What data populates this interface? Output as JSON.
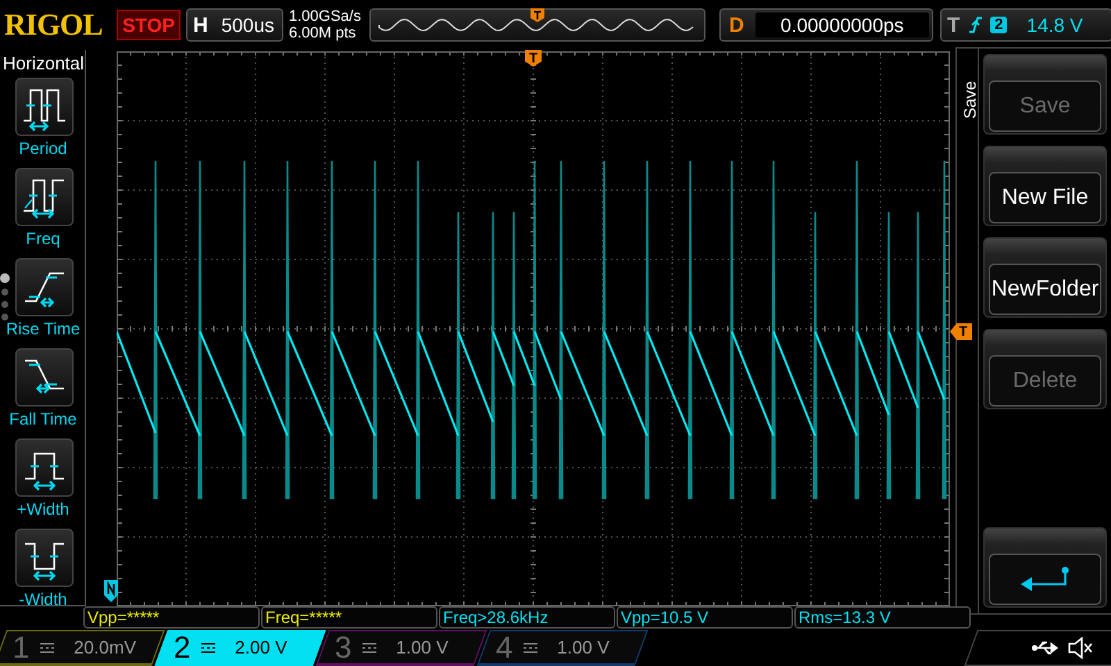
{
  "brand": "RIGOL",
  "run_state": "STOP",
  "horizontal": {
    "label": "H",
    "timebase": "500us",
    "sample_rate": "1.00GSa/s",
    "memory_depth": "6.00M pts"
  },
  "delay": {
    "label": "D",
    "value": "0.00000000ps"
  },
  "trigger": {
    "label": "T",
    "source": "2",
    "level": "14.8 V"
  },
  "measure_menu": {
    "title": "Horizontal",
    "items": [
      {
        "label": "Period",
        "kind": "period"
      },
      {
        "label": "Freq",
        "kind": "freq"
      },
      {
        "label": "Rise Time",
        "kind": "rise"
      },
      {
        "label": "Fall Time",
        "kind": "fall"
      },
      {
        "label": "+Width",
        "kind": "pwidth"
      },
      {
        "label": "-Width",
        "kind": "nwidth"
      }
    ],
    "pages": [
      {
        "selected": true
      },
      {
        "selected": false
      },
      {
        "selected": false
      },
      {
        "selected": false
      }
    ]
  },
  "markers": {
    "trigger_position": "T",
    "trigger_level": "T"
  },
  "measurements": [
    {
      "text": "Vpp=*****",
      "color": "#e8e800"
    },
    {
      "text": "Freq=*****",
      "color": "#e8e800"
    },
    {
      "text": "Freq>28.6kHz",
      "color": "#00e0f0"
    },
    {
      "text": "Vpp=10.5 V",
      "color": "#00e0f0"
    },
    {
      "text": "Rms=13.3 V",
      "color": "#00e0f0"
    }
  ],
  "channels": [
    {
      "number": "1",
      "scale": "20.0mV",
      "color": "#6a6a10",
      "selected": false
    },
    {
      "number": "2",
      "scale": "2.00 V",
      "color": "#00e0f0",
      "selected": true
    },
    {
      "number": "3",
      "scale": "1.00 V",
      "color": "#601060",
      "selected": false
    },
    {
      "number": "4",
      "scale": "1.00 V",
      "color": "#103a6a",
      "selected": false
    }
  ],
  "softkeys": {
    "menu_title": "Save",
    "buttons": [
      {
        "kind": "text",
        "label": "Save",
        "disabled": true
      },
      {
        "kind": "text",
        "label": "New File",
        "disabled": false
      },
      {
        "kind": "text",
        "label": "NewFolder",
        "disabled": false
      },
      {
        "kind": "text",
        "label": "Delete",
        "disabled": true
      },
      {
        "kind": "return"
      }
    ]
  }
}
